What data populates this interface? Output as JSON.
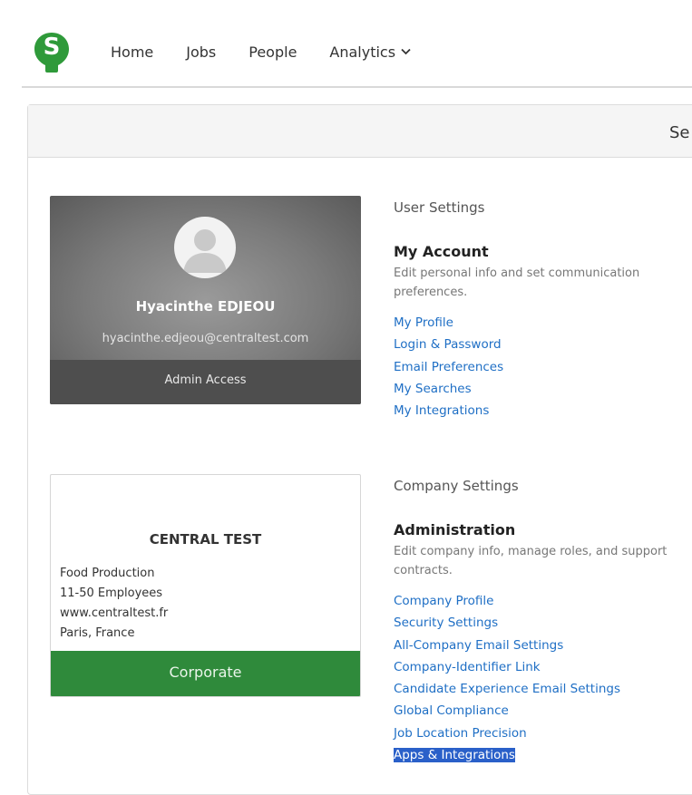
{
  "nav": {
    "logo_letter": "S",
    "items": [
      {
        "label": "Home"
      },
      {
        "label": "Jobs"
      },
      {
        "label": "People"
      },
      {
        "label": "Analytics"
      }
    ]
  },
  "panel": {
    "title": "Se"
  },
  "user_card": {
    "name": "Hyacinthe EDJEOU",
    "email": "hyacinthe.edjeou@centraltest.com",
    "access": "Admin Access"
  },
  "company_card": {
    "name": "CENTRAL TEST",
    "industry": "Food Production",
    "size": "11-50 Employees",
    "website": "www.centraltest.fr",
    "location": "Paris, France",
    "plan": "Corporate"
  },
  "user_settings": {
    "section_title": "User Settings",
    "group_title": "My Account",
    "group_desc": "Edit personal info and set communication preferences.",
    "links": [
      {
        "label": "My Profile"
      },
      {
        "label": "Login & Password"
      },
      {
        "label": "Email Preferences"
      },
      {
        "label": "My Searches"
      },
      {
        "label": "My Integrations"
      }
    ]
  },
  "company_settings": {
    "section_title": "Company Settings",
    "group_title": "Administration",
    "group_desc": "Edit company info, manage roles, and support contracts.",
    "links": [
      {
        "label": "Company Profile"
      },
      {
        "label": "Security Settings"
      },
      {
        "label": "All-Company Email Settings"
      },
      {
        "label": "Company-Identifier Link"
      },
      {
        "label": "Candidate Experience Email Settings"
      },
      {
        "label": "Global Compliance"
      },
      {
        "label": "Job Location Precision"
      },
      {
        "label": "Apps & Integrations",
        "selected": true
      }
    ]
  },
  "colors": {
    "brand_green": "#2f9a3a",
    "link_blue": "#1f6fc5",
    "plan_green": "#2f8a3b",
    "selection_blue": "#2a60c9"
  }
}
